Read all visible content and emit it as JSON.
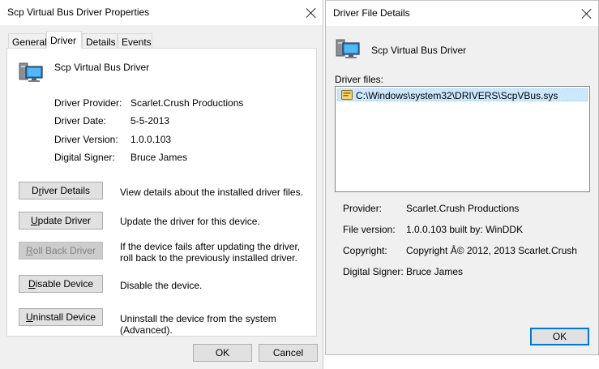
{
  "left_dialog": {
    "title": "Scp Virtual Bus Driver Properties",
    "tabs": [
      "General",
      "Driver",
      "Details",
      "Events"
    ],
    "active_tab": "Driver",
    "device_name": "Scp Virtual Bus Driver",
    "fields": [
      {
        "label": "Driver Provider:",
        "value": "Scarlet.Crush Productions"
      },
      {
        "label": "Driver Date:",
        "value": "5-5-2013"
      },
      {
        "label": "Driver Version:",
        "value": "1.0.0.103"
      },
      {
        "label": "Digital Signer:",
        "value": "Bruce James"
      }
    ],
    "actions": [
      {
        "button_pre": "D",
        "button_ul": "r",
        "button_post": "iver Details",
        "description": "View details about the installed driver files.",
        "enabled": true
      },
      {
        "button_pre": "",
        "button_ul": "U",
        "button_post": "pdate Driver",
        "description": "Update the driver for this device.",
        "enabled": true
      },
      {
        "button_pre": "",
        "button_ul": "R",
        "button_post": "oll Back Driver",
        "description": "If the device fails after updating the driver, roll back to the previously installed driver.",
        "enabled": false
      },
      {
        "button_pre": "",
        "button_ul": "D",
        "button_post": "isable Device",
        "description": "Disable the device.",
        "enabled": true
      },
      {
        "button_pre": "",
        "button_ul": "U",
        "button_post": "ninstall Device",
        "description": "Uninstall the device from the system (Advanced).",
        "enabled": true
      }
    ],
    "ok_label": "OK",
    "cancel_label": "Cancel"
  },
  "right_dialog": {
    "title": "Driver File Details",
    "device_name": "Scp Virtual Bus Driver",
    "files_label": "Driver files:",
    "files": [
      "C:\\Windows\\system32\\DRIVERS\\ScpVBus.sys"
    ],
    "details": [
      {
        "label": "Provider:",
        "value": "Scarlet.Crush Productions"
      },
      {
        "label": "File version:",
        "value": "1.0.0.103 built by: WinDDK"
      },
      {
        "label": "Copyright:",
        "value": "Copyright Â© 2012, 2013 Scarlet.Crush"
      },
      {
        "label": "Digital Signer:",
        "value": "Bruce James"
      }
    ],
    "ok_label": "OK"
  },
  "colors": {
    "accent": "#0078d7",
    "selection": "#cce8ff",
    "dialog_bg": "#f0f0f0",
    "button_bg": "#e1e1e1"
  }
}
